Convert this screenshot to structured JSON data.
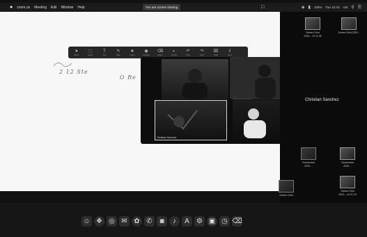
{
  "menubar": {
    "apple": "",
    "items": [
      "zoom.us",
      "Meeting",
      "Edit",
      "Window",
      "Help"
    ],
    "share_banner": "You are screen sharing",
    "status": [
      "100%",
      "Tue 10:43",
      "AM"
    ]
  },
  "whiteboard": {
    "lines": [
      "2 12 Ste",
      "O Re"
    ]
  },
  "annotate_toolbar": {
    "tools": [
      {
        "icon": "mouse-icon",
        "glyph": "➤",
        "label": "Mouse"
      },
      {
        "icon": "select-icon",
        "glyph": "⬚",
        "label": "Select"
      },
      {
        "icon": "text-icon",
        "glyph": "T",
        "label": "Text"
      },
      {
        "icon": "draw-icon",
        "glyph": "✎",
        "label": "Draw"
      },
      {
        "icon": "stamp-icon",
        "glyph": "★",
        "label": "Stamp"
      },
      {
        "icon": "spotlight-icon",
        "glyph": "◉",
        "label": "Spotlight"
      },
      {
        "icon": "eraser-icon",
        "glyph": "⌫",
        "label": "Eraser"
      },
      {
        "icon": "format-icon",
        "glyph": "◐",
        "label": "Format"
      },
      {
        "icon": "undo-icon",
        "glyph": "↶",
        "label": "Undo"
      },
      {
        "icon": "redo-icon",
        "glyph": "↷",
        "label": "Redo"
      },
      {
        "icon": "clear-icon",
        "glyph": "⌧",
        "label": "Clear"
      },
      {
        "icon": "save-icon",
        "glyph": "⇩",
        "label": "Save"
      }
    ]
  },
  "participants": [
    {
      "name": ""
    },
    {
      "name": ""
    },
    {
      "name": "Christian Sanchez"
    },
    {
      "name": ""
    }
  ],
  "active_speaker": "Christian Sanchez",
  "desktop": {
    "icons": [
      {
        "caption_lines": [
          "Screen Shot",
          "2020-...19.11.08"
        ]
      },
      {
        "caption_lines": [
          "Screen Shot 2020..."
        ]
      },
      {
        "caption_lines": [
          "Screenshot",
          "2020-..."
        ]
      },
      {
        "caption_lines": [
          "Screenshot",
          "2020-..."
        ]
      },
      {
        "caption_lines": [
          "Screen Shot",
          "2020-..."
        ]
      },
      {
        "caption_lines": [
          "Screen Shot",
          "2020-...19.21.23"
        ]
      }
    ]
  },
  "dock": {
    "icons": [
      {
        "name": "finder-icon",
        "glyph": "☺"
      },
      {
        "name": "launchpad-icon",
        "glyph": "❖"
      },
      {
        "name": "safari-icon",
        "glyph": "◎"
      },
      {
        "name": "mail-icon",
        "glyph": "✉"
      },
      {
        "name": "photos-icon",
        "glyph": "✿"
      },
      {
        "name": "messages-icon",
        "glyph": "✆"
      },
      {
        "name": "zoom-icon",
        "glyph": "◙"
      },
      {
        "name": "music-icon",
        "glyph": "♪"
      },
      {
        "name": "app-store-icon",
        "glyph": "A"
      },
      {
        "name": "settings-icon",
        "glyph": "⚙"
      },
      {
        "name": "preview-icon",
        "glyph": "▣"
      },
      {
        "name": "clock-icon",
        "glyph": "◷"
      },
      {
        "name": "trash-icon",
        "glyph": "⌫"
      }
    ]
  },
  "colors": {
    "menubar": "#1b1b1b",
    "whiteboard": "#f7f7f7",
    "desktop": "#0b0b0b",
    "dock": "#161616"
  }
}
